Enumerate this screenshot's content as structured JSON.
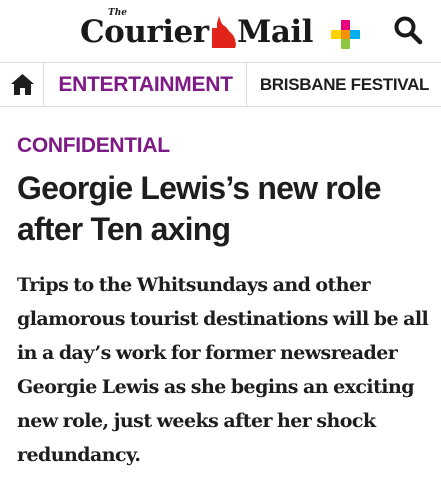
{
  "masthead": {
    "logo_the": "The",
    "logo_left": "Courier",
    "logo_right": "Mail",
    "search_icon": "search-icon",
    "colors": {
      "qld_red": "#e2231a",
      "plus_pink": "#e6007e",
      "plus_yellow": "#ffd200",
      "plus_blue": "#00aeef",
      "plus_green": "#8dc63f"
    }
  },
  "nav": {
    "home_icon": "home-icon",
    "section": "ENTERTAINMENT",
    "subsection": "BRISBANE FESTIVAL",
    "accent_color": "#7d1a86"
  },
  "article": {
    "kicker": "CONFIDENTIAL",
    "headline": "Georgie Lewis’s new role after Ten axing",
    "standfirst": "Trips to the Whitsundays and other glamorous tourist destinations will be all in a day’s work for former newsreader Georgie Lewis as she begins an exciting new role, just weeks after her shock redundancy."
  }
}
